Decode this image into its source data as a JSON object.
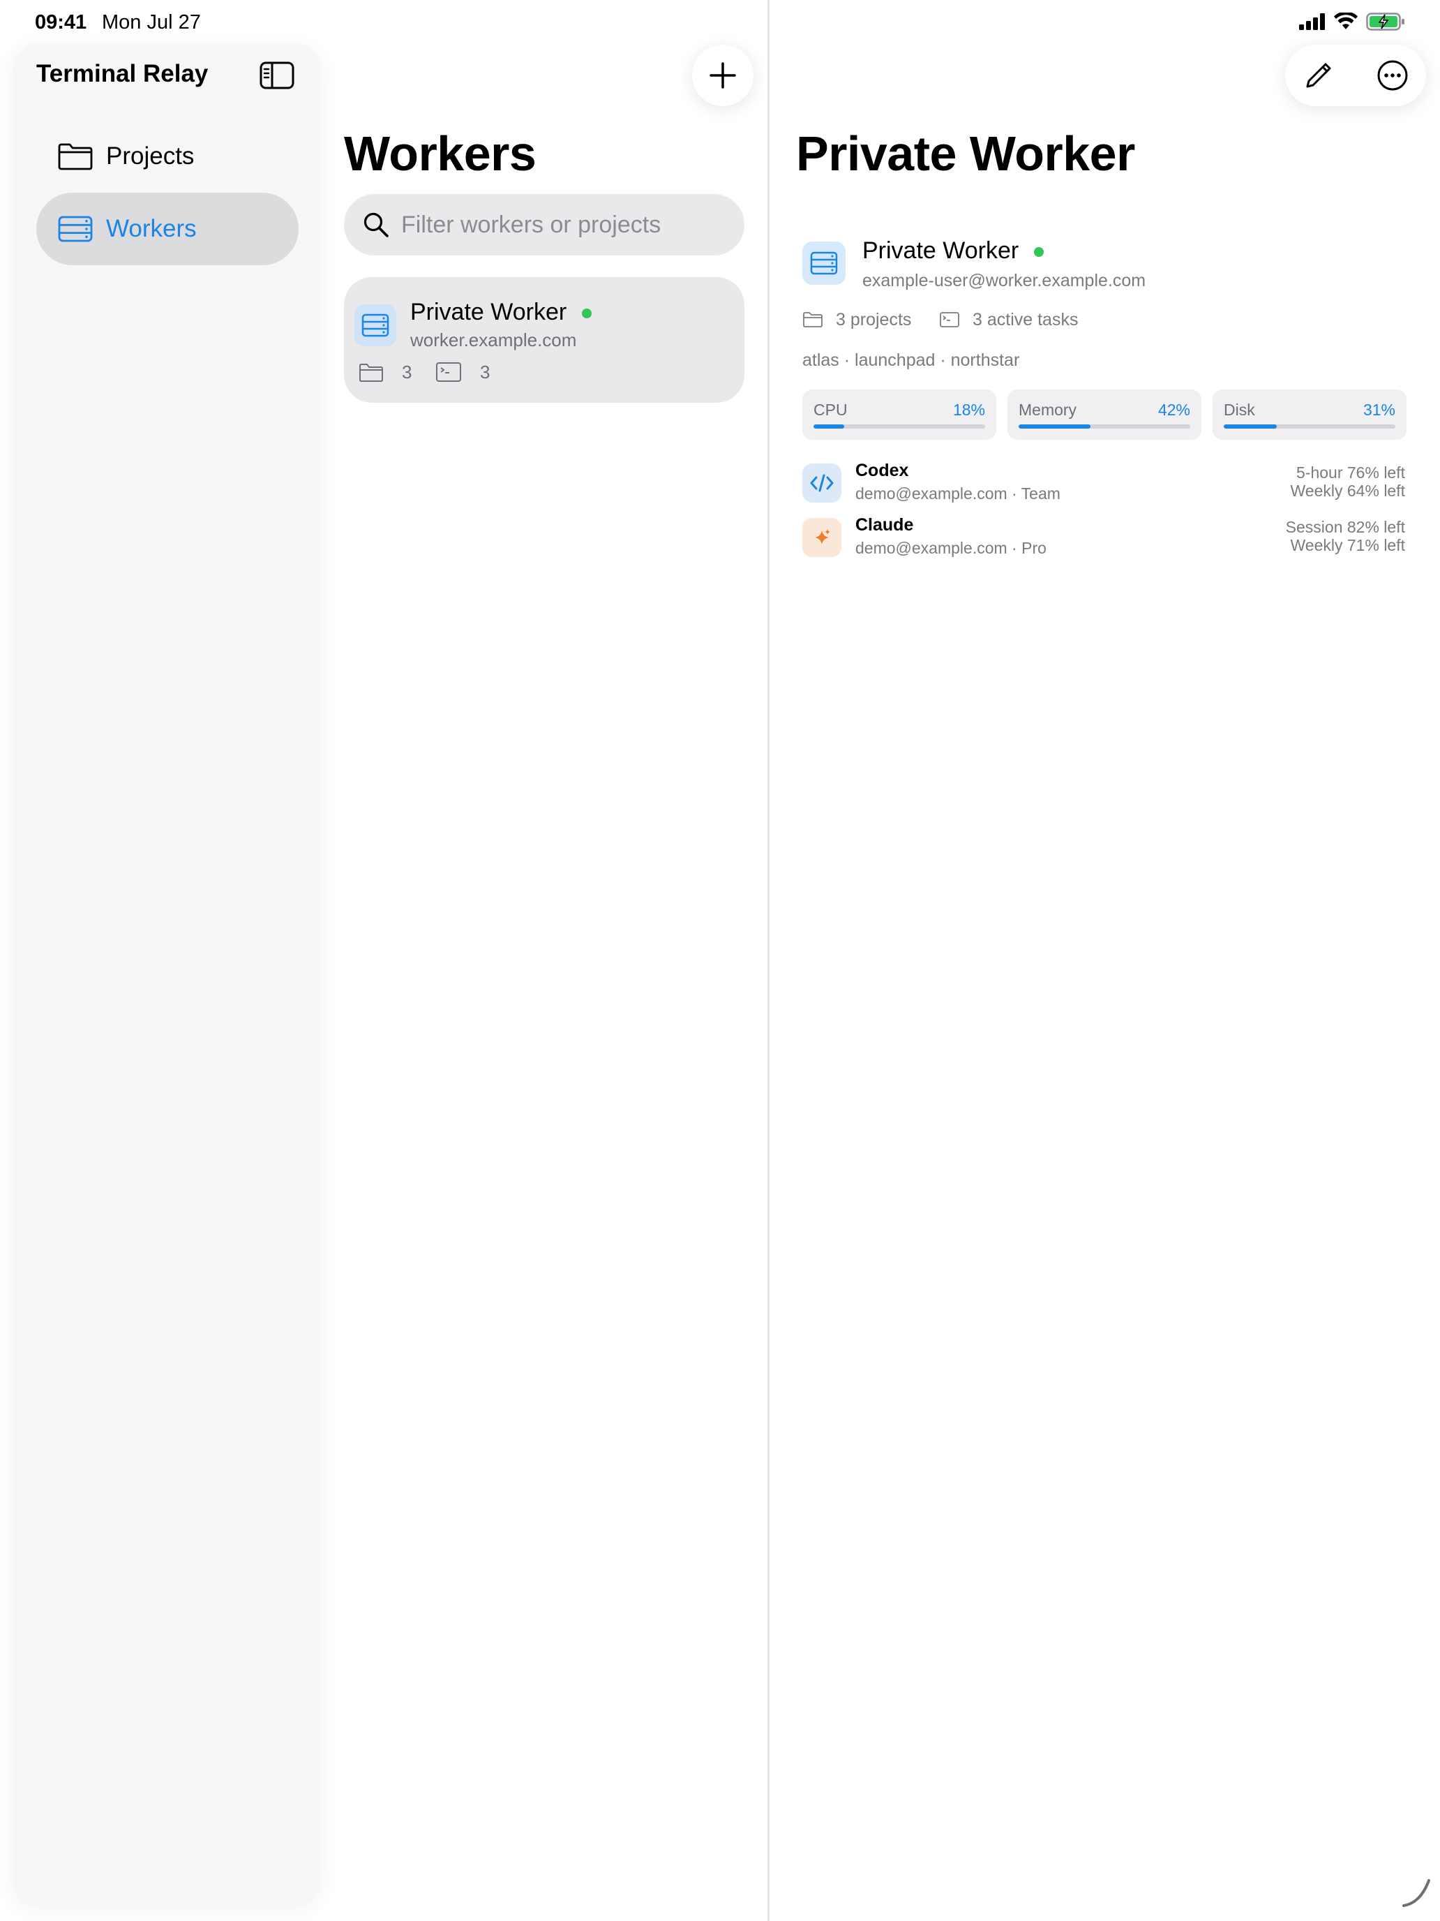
{
  "status": {
    "time": "09:41",
    "date": "Mon Jul 27"
  },
  "colors": {
    "accent": "#1a85e6",
    "online": "#30c758",
    "claude_accent": "#f07a28"
  },
  "sidebar": {
    "title": "Terminal Relay",
    "items": [
      {
        "label": "Projects",
        "icon": "folder-icon"
      },
      {
        "label": "Workers",
        "icon": "server-icon",
        "selected": true
      }
    ]
  },
  "workers_list": {
    "title": "Workers",
    "search_placeholder": "Filter workers or projects",
    "items": [
      {
        "name": "Private Worker",
        "host": "worker.example.com",
        "projects_count": "3",
        "tasks_count": "3",
        "online": true
      }
    ]
  },
  "detail": {
    "title": "Private Worker",
    "name": "Private Worker",
    "host": "example-user@worker.example.com",
    "projects": "3 projects",
    "tasks": "3 active tasks",
    "tags": "atlas · launchpad · northstar",
    "metrics": [
      {
        "label": "CPU",
        "value": "18%",
        "fraction": 0.18
      },
      {
        "label": "Memory",
        "value": "42%",
        "fraction": 0.42
      },
      {
        "label": "Disk",
        "value": "31%",
        "fraction": 0.31
      }
    ],
    "services": [
      {
        "name": "Codex",
        "account": "demo@example.com · Team",
        "quota_1": "5-hour 76% left",
        "quota_2": "Weekly 64% left",
        "icon": "code-icon"
      },
      {
        "name": "Claude",
        "account": "demo@example.com · Pro",
        "quota_1": "Session 82% left",
        "quota_2": "Weekly 71% left",
        "icon": "sparkle-icon"
      }
    ]
  }
}
